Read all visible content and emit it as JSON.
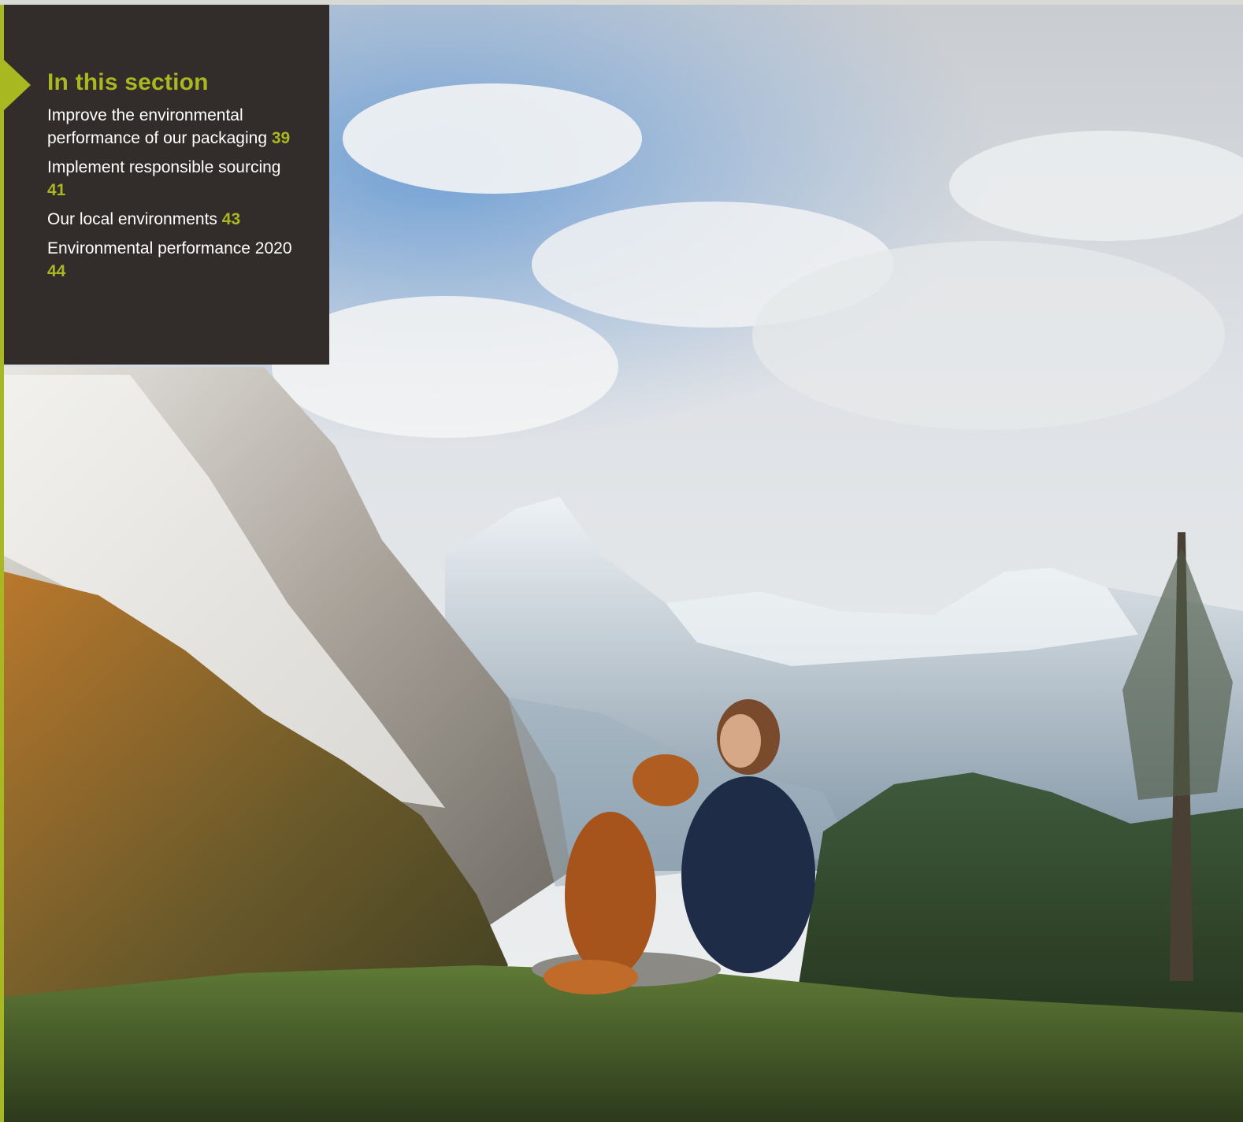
{
  "sidebar": {
    "title": "In this section",
    "items": [
      {
        "label": "Improve the environmental performance of our packaging",
        "page": "39"
      },
      {
        "label": "Implement responsible sourcing",
        "page": "41"
      },
      {
        "label": "Our local environments",
        "page": "43"
      },
      {
        "label": "Environmental performance 2020",
        "page": "44"
      }
    ]
  },
  "colors": {
    "accent": "#a8b820",
    "panel": "#322c2b",
    "text": "#ffffff"
  },
  "icons": {
    "section_marker": "arrow-right-icon"
  }
}
